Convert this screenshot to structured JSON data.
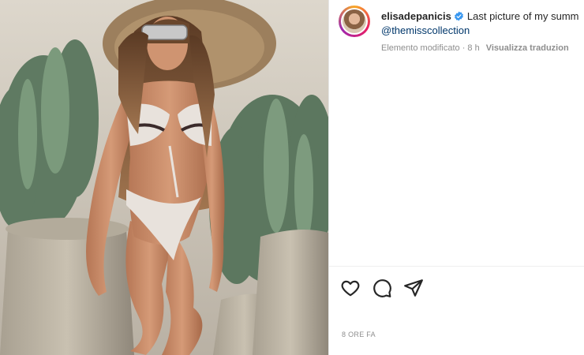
{
  "post": {
    "username": "elisadepanicis",
    "caption": "Last picture of my summ",
    "mention": "@themisscollection",
    "edited": "Elemento modificato · 8 h",
    "translate": "Visualizza traduzion",
    "timestamp": "8 ORE FA"
  },
  "icons": {
    "verified": "verified-badge-icon",
    "like": "heart-icon",
    "comment": "comment-icon",
    "share": "paper-plane-icon"
  },
  "colors": {
    "verified": "#3897f0",
    "link": "#00376b",
    "muted": "#8e8e8e",
    "text": "#262626"
  }
}
